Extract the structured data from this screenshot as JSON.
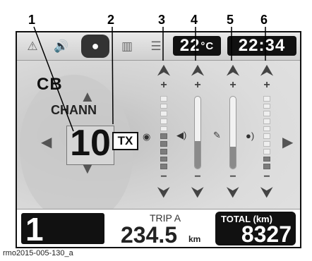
{
  "callouts": [
    "1",
    "2",
    "3",
    "4",
    "5",
    "6"
  ],
  "top_bar": {
    "icons": [
      "warning-icon",
      "speaker-icon",
      "head-icon",
      "book-icon",
      "menu-icon"
    ],
    "temperature": "22",
    "temperature_unit": "°C",
    "clock": "22:34"
  },
  "audio_source": "CB",
  "channel": {
    "label": "CHANN",
    "value": "10",
    "tx_label": "TX"
  },
  "level_columns": [
    {
      "callout": "3",
      "icon": "intercom-icon",
      "style": "segments",
      "level": 0.5
    },
    {
      "callout": "4",
      "icon": "volume-icon",
      "style": "tube",
      "level": 0.38
    },
    {
      "callout": "5",
      "icon": "microphone-icon",
      "style": "tube",
      "level": 0.3
    },
    {
      "callout": "6",
      "icon": "head-speaker-icon",
      "style": "segments",
      "level": 0.2
    }
  ],
  "gear": "1",
  "trip": {
    "label": "TRIP A",
    "value": "234.5",
    "unit": "km"
  },
  "total": {
    "label": "TOTAL (km)",
    "value": "8327"
  },
  "caption": "rmo2015-005-130_a",
  "colors": {
    "screen_bg": "#d8d8d8",
    "lcd_bg": "#111111",
    "selected_icon_bg": "#333333"
  }
}
